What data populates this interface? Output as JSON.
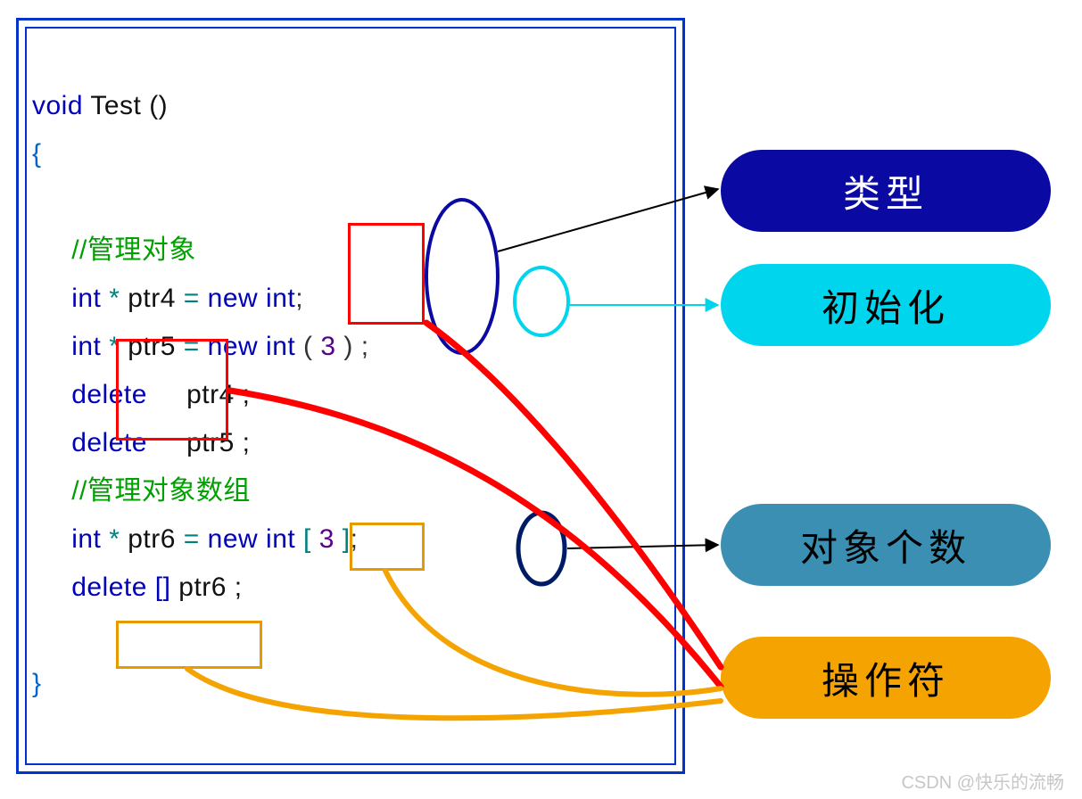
{
  "code": {
    "sig_void": "void",
    "sig_name": " Test ()",
    "brace_open": "{",
    "comment1": "//管理对象",
    "l4_kw1": "int",
    "l4_star": " * ",
    "l4_id": "ptr4",
    "l4_eq": " = ",
    "l4_new": "new",
    "l4_kw2": " int",
    "l4_semi": ";",
    "l5_kw1": "int",
    "l5_star": " * ",
    "l5_id": "ptr5",
    "l5_eq": " = ",
    "l5_new": "new",
    "l5_kw2": " int ",
    "l5_lp": "(",
    "l5_num": " 3 ",
    "l5_rp": ")",
    "l5_semi": " ;",
    "l6_del": "delete",
    "l6_id": "     ptr4 ;",
    "l7_del": "delete",
    "l7_id": "     ptr5 ;",
    "comment2": "//管理对象数组",
    "l9_kw1": "int",
    "l9_star": " * ",
    "l9_id": "ptr6",
    "l9_eq": " = ",
    "l9_new": "new",
    "l9_kw2": " int ",
    "l9_lb": "[",
    "l9_num": " 3 ",
    "l9_rb": "]",
    "l9_semi": ";",
    "l10_del": "delete []",
    "l10_id": " ptr6 ;",
    "brace_close": "}"
  },
  "labels": {
    "type": "类型",
    "init": "初始化",
    "count": "对象个数",
    "operator": "操作符"
  },
  "watermark": "CSDN @快乐的流畅"
}
